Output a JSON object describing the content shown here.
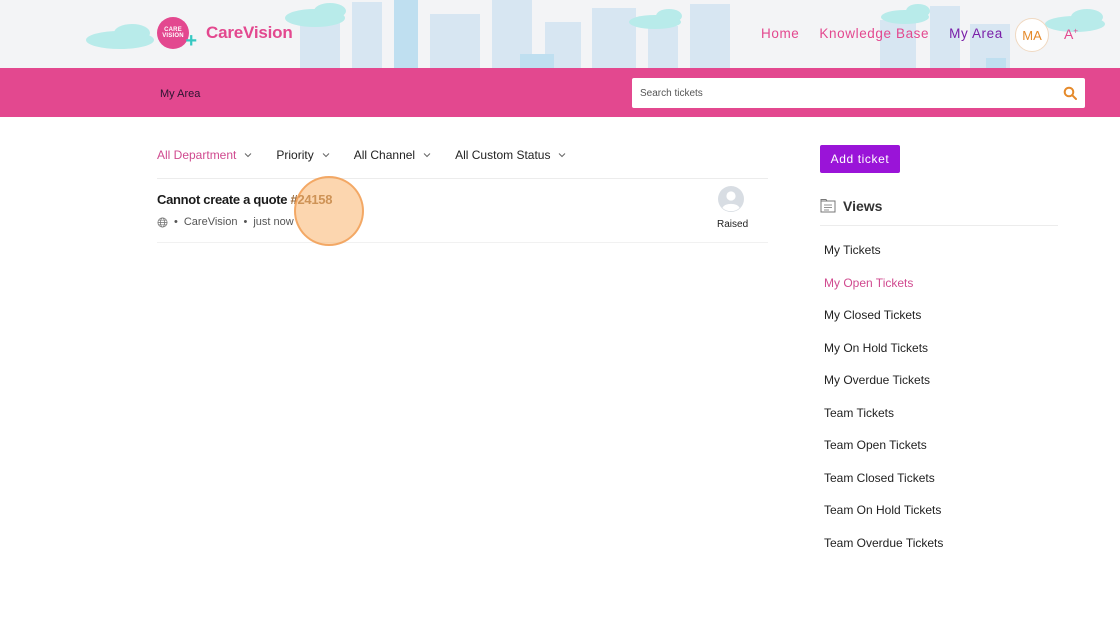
{
  "header": {
    "logo_badge_text": "CARE VISION",
    "logo_name": "CareVision",
    "nav": [
      {
        "label": "Home"
      },
      {
        "label": "Knowledge Base"
      },
      {
        "label": "My Area"
      }
    ],
    "avatar_initials": "MA",
    "font_size_label": "A"
  },
  "subbar": {
    "breadcrumb": "My Area",
    "search_placeholder": "Search tickets"
  },
  "filters": [
    {
      "label": "All Department"
    },
    {
      "label": "Priority"
    },
    {
      "label": "All Channel"
    },
    {
      "label": "All Custom Status"
    }
  ],
  "ticket": {
    "title": "Cannot create a quote",
    "id": "#24158",
    "org": "CareVision",
    "time": "just now",
    "status": "Raised"
  },
  "sidebar": {
    "add_ticket": "Add ticket",
    "views_title": "Views",
    "views": [
      "My Tickets",
      "My Open Tickets",
      "My Closed Tickets",
      "My On Hold Tickets",
      "My Overdue Tickets",
      "Team Tickets",
      "Team Open Tickets",
      "Team Closed Tickets",
      "Team On Hold Tickets",
      "Team Overdue Tickets"
    ]
  },
  "colors": {
    "brand_pink": "#e3488f",
    "accent_purple": "#9a14d8",
    "active_link": "#d04a8f"
  }
}
